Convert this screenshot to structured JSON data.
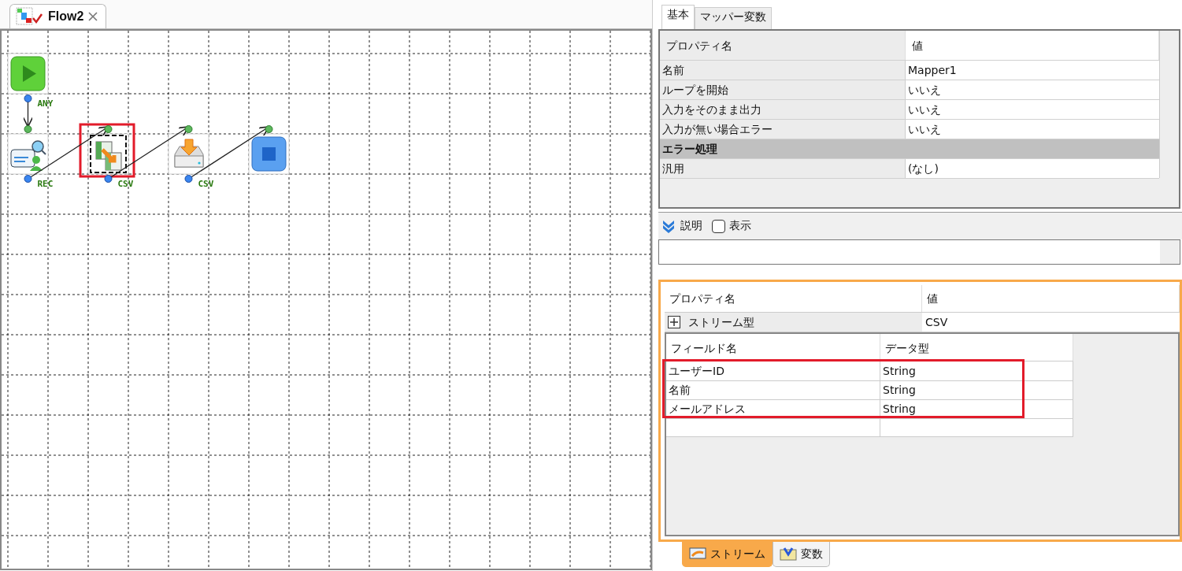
{
  "editor_tab": {
    "title": "Flow2"
  },
  "flow": {
    "nodes": [
      {
        "kind": "start",
        "port_label": "ANY",
        "selected": false,
        "highlighted": false
      },
      {
        "kind": "reader",
        "port_label": "REC",
        "selected": false,
        "highlighted": false
      },
      {
        "kind": "mapper",
        "port_label": "CSV",
        "selected": true,
        "highlighted": true
      },
      {
        "kind": "writer",
        "port_label": "CSV",
        "selected": false,
        "highlighted": false
      },
      {
        "kind": "end",
        "selected": false,
        "highlighted": false
      }
    ]
  },
  "property_tabs": [
    {
      "label": "基本",
      "selected": true
    },
    {
      "label": "マッパー変数",
      "selected": false
    }
  ],
  "properties": {
    "columns": [
      "プロパティ名",
      "値"
    ],
    "rows": [
      {
        "kind": "property",
        "name": "名前",
        "value": "Mapper1"
      },
      {
        "kind": "property",
        "name": "ループを開始",
        "value": "いいえ"
      },
      {
        "kind": "property",
        "name": "入力をそのまま出力",
        "value": "いいえ"
      },
      {
        "kind": "property",
        "name": "入力が無い場合エラー",
        "value": "いいえ"
      },
      {
        "kind": "section",
        "name": "エラー処理"
      },
      {
        "kind": "property",
        "name": "汎用",
        "value": "(なし)"
      }
    ]
  },
  "description": {
    "label": "説明",
    "show_checkbox": {
      "label": "表示",
      "checked": false
    }
  },
  "stream": {
    "columns": [
      "プロパティ名",
      "値"
    ],
    "row": {
      "name": "ストリーム型",
      "value": "CSV",
      "expanded": false
    },
    "field_table": {
      "columns": [
        "フィールド名",
        "データ型"
      ],
      "highlighted": true,
      "rows": [
        {
          "name": "ユーザーID",
          "type": "String"
        },
        {
          "name": "名前",
          "type": "String"
        },
        {
          "name": "メールアドレス",
          "type": "String"
        }
      ]
    }
  },
  "bottom_tabs": [
    {
      "label": "ストリーム",
      "selected": true
    },
    {
      "label": "変数",
      "selected": false
    }
  ]
}
